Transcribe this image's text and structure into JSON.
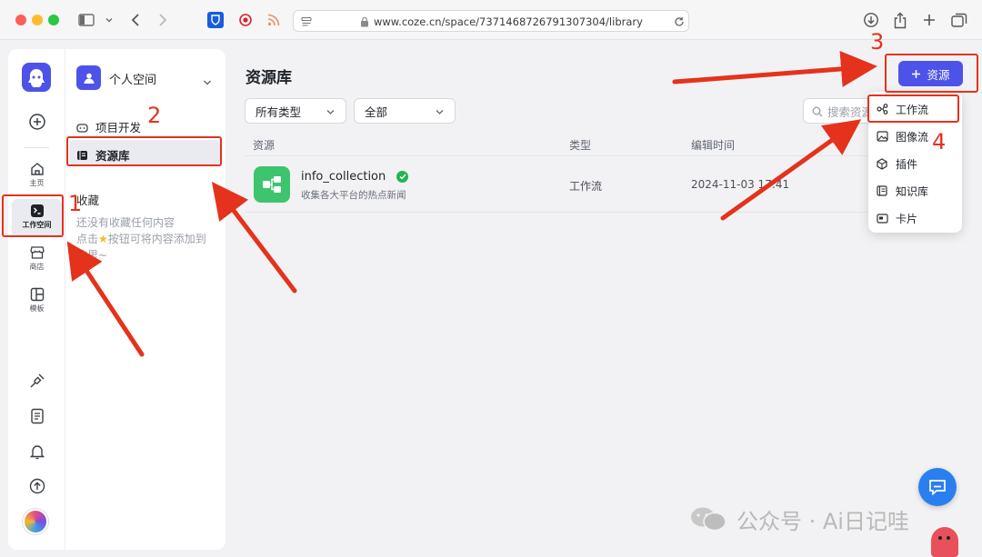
{
  "browser": {
    "url": "www.coze.cn/space/7371468726791307304/library"
  },
  "rail": {
    "items": [
      {
        "label": "主页"
      },
      {
        "label": "工作空间"
      },
      {
        "label": "商店"
      },
      {
        "label": "模板"
      }
    ]
  },
  "sidebar": {
    "space_name": "个人空间",
    "nav": [
      {
        "label": "项目开发"
      },
      {
        "label": "资源库"
      }
    ],
    "favorites": {
      "title": "收藏",
      "empty_line1": "还没有收藏任何内容",
      "empty_line2_a": "点击",
      "empty_line2_b": "按钮可将内容添加到",
      "empty_line3": "这里~"
    }
  },
  "main": {
    "title": "资源库",
    "filters": {
      "type": "所有类型",
      "scope": "全部"
    },
    "search_placeholder": "搜索资源",
    "add_button": "资源",
    "columns": [
      "资源",
      "类型",
      "编辑时间"
    ],
    "rows": [
      {
        "name": "info_collection",
        "desc": "收集各大平台的热点新闻",
        "type": "工作流",
        "time": "2024-11-03 17:41"
      }
    ]
  },
  "dropdown": {
    "items": [
      {
        "label": "工作流",
        "icon": "workflow-icon"
      },
      {
        "label": "图像流",
        "icon": "image-flow-icon"
      },
      {
        "label": "插件",
        "icon": "plugin-icon"
      },
      {
        "label": "知识库",
        "icon": "knowledge-icon"
      },
      {
        "label": "卡片",
        "icon": "card-icon"
      }
    ]
  },
  "annotations": {
    "n1": "1",
    "n2": "2",
    "n3": "3",
    "n4": "4"
  },
  "watermark": {
    "text": "公众号 · Ai日记哇"
  },
  "colors": {
    "accent": "#4d53e8",
    "arrow": "#e5321c",
    "success": "#22b455",
    "resource_icon": "#3ec46d"
  }
}
